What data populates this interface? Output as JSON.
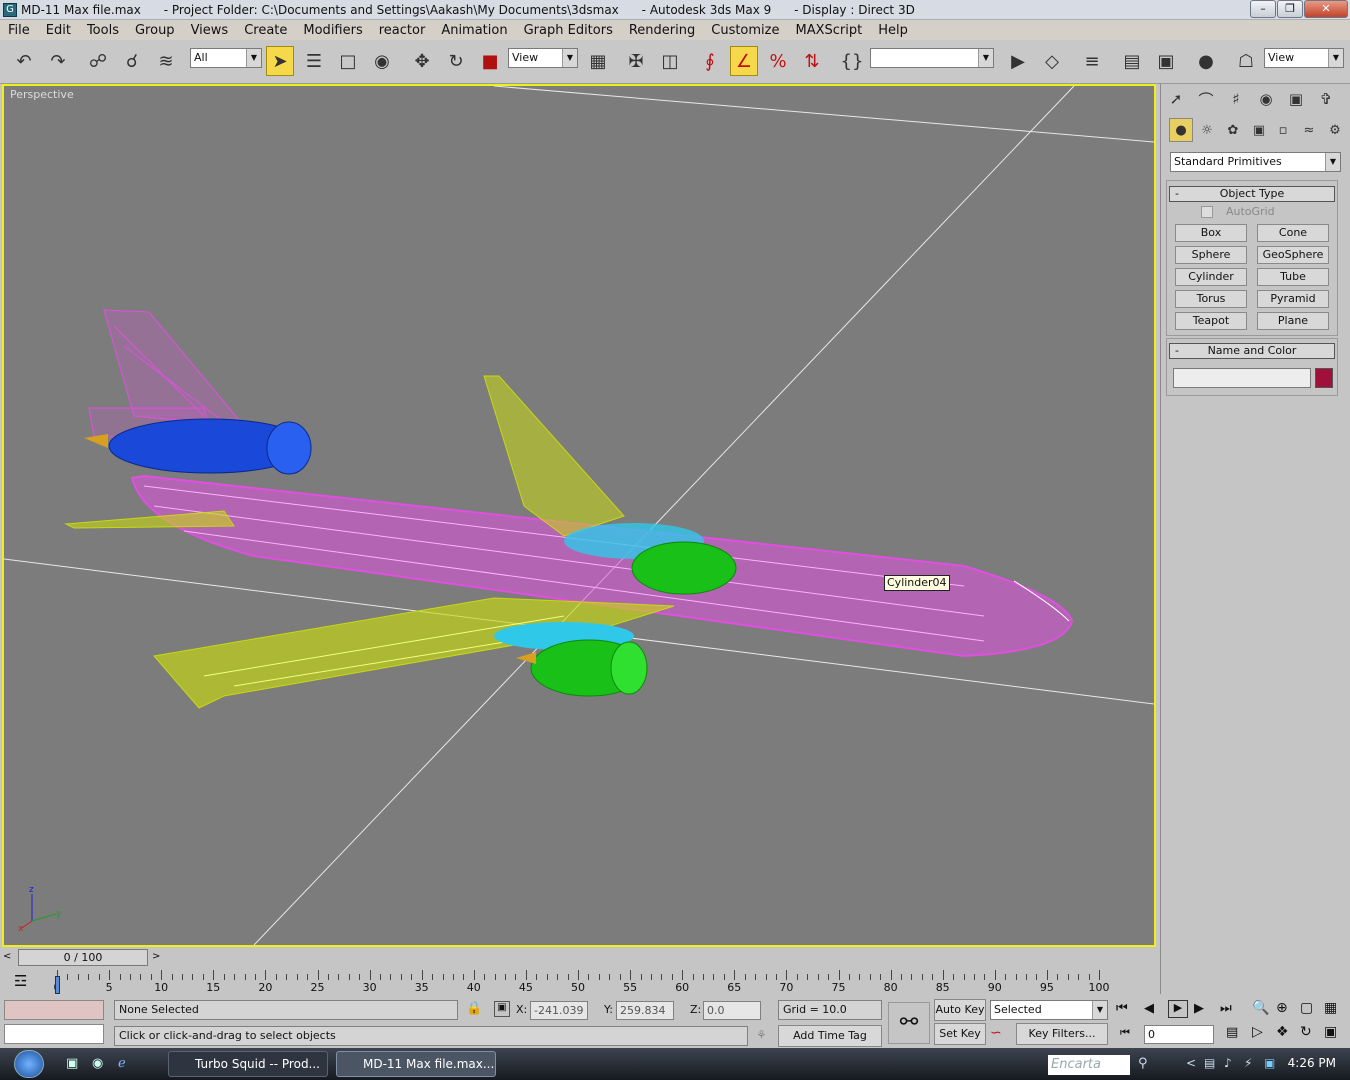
{
  "window": {
    "title": "MD-11 Max file.max      - Project Folder: C:\\Documents and Settings\\Aakash\\My Documents\\3dsmax      - Autodesk 3ds Max 9      - Display : Direct 3D"
  },
  "menu": [
    "File",
    "Edit",
    "Tools",
    "Group",
    "Views",
    "Create",
    "Modifiers",
    "reactor",
    "Animation",
    "Graph Editors",
    "Rendering",
    "Customize",
    "MAXScript",
    "Help"
  ],
  "toolbar": {
    "selection_filter": "All",
    "ref_coord": "View",
    "named_selection": "",
    "render_preset": "View"
  },
  "viewport": {
    "label": "Perspective",
    "tooltip": "Cylinder04",
    "axis_z": "z",
    "axis_x": "x",
    "axis_y": "y",
    "colors": {
      "background": "#7c7c7c",
      "fuselage": "#e050e0",
      "wings": "#c8d810",
      "engine_blue": "#1a48d8",
      "engine_green": "#18c018",
      "engine_cyan": "#30c8e8",
      "border": "#f0ef1a"
    }
  },
  "command_panel": {
    "category": "Standard Primitives",
    "object_type_title": "Object Type",
    "autogrid": "AutoGrid",
    "buttons": [
      "Box",
      "Cone",
      "Sphere",
      "GeoSphere",
      "Cylinder",
      "Tube",
      "Torus",
      "Pyramid",
      "Teapot",
      "Plane"
    ],
    "name_color_title": "Name and Color",
    "rollout_toggle": "-",
    "name_value": "",
    "swatch_color": "#a0103a"
  },
  "timeline": {
    "frame_display": "0 / 100",
    "ticks": [
      "0",
      "5",
      "10",
      "15",
      "20",
      "25",
      "30",
      "35",
      "40",
      "45",
      "50",
      "55",
      "60",
      "65",
      "70",
      "75",
      "80",
      "85",
      "90",
      "95",
      "100"
    ]
  },
  "status": {
    "selection": "None Selected",
    "prompt": "Click or click-and-drag to select objects",
    "x_label": "X:",
    "x_value": "-241.039",
    "y_label": "Y:",
    "y_value": "259.834",
    "z_label": "Z:",
    "z_value": "0.0",
    "grid": "Grid = 10.0",
    "add_time_tag": "Add Time Tag",
    "auto_key": "Auto Key",
    "set_key": "Set Key",
    "key_mode": "Selected",
    "key_filters": "Key Filters...",
    "frame": "0"
  },
  "taskbar": {
    "items": [
      "Turbo Squid -- Prod...",
      "MD-11 Max file.max..."
    ],
    "search": "Encarta",
    "clock": "4:26 PM"
  }
}
